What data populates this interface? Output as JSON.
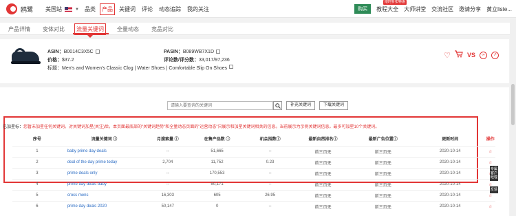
{
  "brand": {
    "name": "鸥鹭",
    "color": "#e23636"
  },
  "site": {
    "label": "美国站",
    "flag_icon": "us-flag-icon"
  },
  "nav": {
    "items": [
      "品类",
      "产品",
      "关键词",
      "评论",
      "动态追踪",
      "我的关注"
    ],
    "active": "产品"
  },
  "nav_right": {
    "buy_label": "购买",
    "promo_tag": "限时折扣特惠",
    "items": [
      "教程大全",
      "大师讲堂",
      "交流社区",
      "邀请分享",
      "黄立liste..."
    ]
  },
  "tabs": [
    "产品详情",
    "变体对比",
    "流量关键词",
    "全量动态",
    "竞品对比"
  ],
  "active_tab": "流量关键词",
  "product": {
    "asin_label": "ASIN：",
    "asin": "B0014C3X5C",
    "pasin_label": "PASIN：",
    "pasin": "B089WB7X1D",
    "price_label": "价格：",
    "price": "$37.2",
    "review_label": "评论数/评分数：",
    "review": "33,017/97,236",
    "title_label": "标题：",
    "title": "Men's and Women's Classic Clog | Water Shoes | Comfortable Slip On Shoes"
  },
  "actions": [
    "heart-icon",
    "cart-icon",
    "vs-icon",
    "link-icon",
    "share-icon"
  ],
  "search": {
    "placeholder": "请输入要查询的关键词",
    "add_label": "补充关键词",
    "download_label": "下载关键词"
  },
  "hint": {
    "lead": "已加星标：",
    "text": "您暂未加星任何关键词。对关键词加星(关注)后，本页面最底部的\"关键词趋势\"和全量动态页面的\"运营动态\"只展示和加星关键词相关的信息。当前展示为示例关键词信息。最多可加星10个关键词。"
  },
  "table": {
    "headers": [
      "序号",
      "流量关键词 ⓘ",
      "月搜索量 ⓘ",
      "在售产品数 ⓘ",
      "机会指数ⓘ",
      "最新自然排名ⓘ",
      "最新广告位置ⓘ",
      "更新时间",
      "操作"
    ],
    "rows": [
      [
        "1",
        "baby prime day deals",
        "--",
        "51,665",
        "--",
        "前三页无",
        "前三页无",
        "2020-10-14",
        "☆"
      ],
      [
        "2",
        "deal of the day prime today",
        "2,704",
        "11,752",
        "0.23",
        "前三页无",
        "前三页无",
        "2020-10-14",
        "☆"
      ],
      [
        "3",
        "prime deals only",
        "--",
        "170,553",
        "--",
        "前三页无",
        "前三页无",
        "2020-10-14",
        "☆"
      ],
      [
        "4",
        "prime day deals baby",
        "--",
        "50,171",
        "--",
        "前三页无",
        "前三页无",
        "2020-10-14",
        "☆"
      ],
      [
        "5",
        "crocs mens",
        "16,303",
        "605",
        "26.95",
        "前三页无",
        "前三页无",
        "2020-10-14",
        "☆"
      ],
      [
        "6",
        "prime day deals 2020",
        "50,147",
        "0",
        "--",
        "前三页无",
        "前三页无",
        "2020-10-14",
        "☆"
      ]
    ]
  },
  "side_tabs": [
    "专属客户经理",
    "反馈"
  ]
}
